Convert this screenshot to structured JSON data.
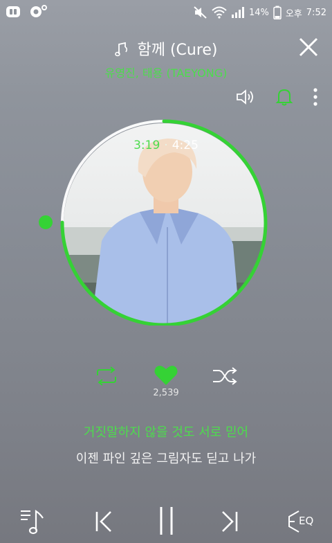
{
  "status_bar": {
    "battery_text": "14%",
    "period": "오후",
    "time": "7:52"
  },
  "player": {
    "title": "함께 (Cure)",
    "artist": "유영진, 태용 (TAEYONG)",
    "current_time": "3:19",
    "time_separator": "·",
    "total_time": "4:25",
    "progress": 0.751,
    "like_count": "2,539",
    "lyric_current": "거짓말하지 않을 것도 서로 믿어",
    "lyric_next": "이젠 파인 깊은 그림자도 딛고 나가"
  },
  "bottom": {
    "eq_label": "EQ"
  },
  "colors": {
    "accent": "#35d235",
    "accent_text": "#4ddc4d",
    "background": "#888d96"
  },
  "icons": {
    "close": "close-icon",
    "speaker": "speaker-icon",
    "alarm": "bell-icon",
    "more": "more-vertical-icon",
    "repeat": "repeat-icon",
    "like": "heart-icon",
    "shuffle": "shuffle-icon",
    "playlist": "playlist-icon",
    "prev": "skip-previous-icon",
    "pause": "pause-icon",
    "next": "skip-next-icon",
    "eq": "eq-icon"
  }
}
